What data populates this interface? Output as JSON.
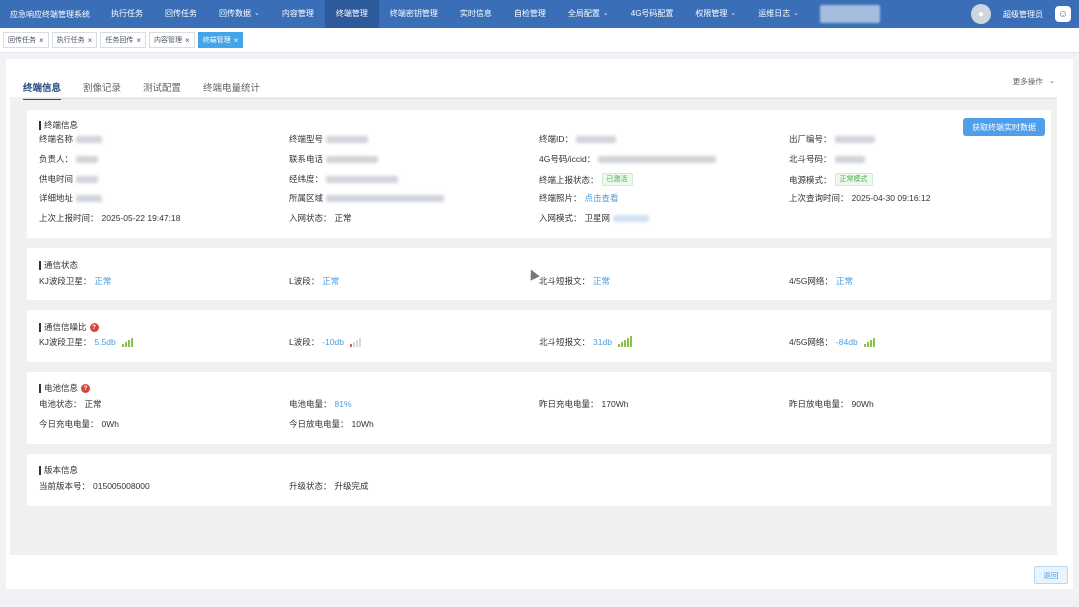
{
  "app": {
    "title": "应急响应终端管理系统",
    "nav": [
      {
        "label": "执行任务",
        "dropdown": false,
        "active": false
      },
      {
        "label": "回传任务",
        "dropdown": false,
        "active": false
      },
      {
        "label": "回传数据",
        "dropdown": true,
        "active": false
      },
      {
        "label": "内容管理",
        "dropdown": false,
        "active": false
      },
      {
        "label": "终端管理",
        "dropdown": false,
        "active": true
      },
      {
        "label": "终端密钥管理",
        "dropdown": false,
        "active": false
      },
      {
        "label": "实时信息",
        "dropdown": false,
        "active": false
      },
      {
        "label": "自检管理",
        "dropdown": false,
        "active": false
      },
      {
        "label": "全局配置",
        "dropdown": true,
        "active": false
      },
      {
        "label": "4G号码配置",
        "dropdown": false,
        "active": false
      },
      {
        "label": "权限管理",
        "dropdown": true,
        "active": false
      },
      {
        "label": "运维日志",
        "dropdown": true,
        "active": false
      }
    ],
    "user": "超级管理员"
  },
  "page_tabs": [
    {
      "label": "回传任务",
      "active": false
    },
    {
      "label": "执行任务",
      "active": false
    },
    {
      "label": "任务回传",
      "active": false
    },
    {
      "label": "内容管理",
      "active": false
    },
    {
      "label": "终端管理",
      "active": true
    }
  ],
  "subtabs": [
    {
      "label": "终端信息",
      "active": true
    },
    {
      "label": "割像记录",
      "active": false
    },
    {
      "label": "测试配置",
      "active": false
    },
    {
      "label": "终端电量统计",
      "active": false
    }
  ],
  "more_ops": "更多操作",
  "terminal_info": {
    "title": "终端信息",
    "fetch_button": "获取终端实时数据",
    "labels": {
      "name": "终端名称",
      "model": "终端型号",
      "terminal_id": "终端ID：",
      "factory_no": "出厂编号：",
      "owner": "负责人：",
      "phone": "联系电话",
      "iccid": "4G号码/iccid：",
      "beidou_no": "北斗号码：",
      "install_time": "供电时间",
      "coords": "经纬度：",
      "report_status": "终端上报状态：",
      "power_mode": "电源模式：",
      "address": "详细地址",
      "region": "所属区域",
      "photo": "终端照片：",
      "last_query": "上次查询时间：",
      "last_report": "上次上报时间：",
      "net_status": "入网状态：",
      "net_mode": "入网模式："
    },
    "values": {
      "report_status": "已激活",
      "power_mode": "正常模式",
      "photo": "点击查看",
      "last_query": "2025-04-30 09:16:12",
      "last_report": "2025-05-22 19:47:18",
      "net_status": "正常",
      "net_mode": "卫星网"
    }
  },
  "comm_status": {
    "title": "通信状态",
    "items": [
      {
        "label": "KJ波段卫星：",
        "value": "正常"
      },
      {
        "label": "L波段：",
        "value": "正常"
      },
      {
        "label": "北斗短报文：",
        "value": "正常"
      },
      {
        "label": "4/5G网络：",
        "value": "正常"
      }
    ]
  },
  "signal_ratio": {
    "title": "通信信噪比",
    "items": [
      {
        "label": "KJ波段卫星：",
        "value": "5.5db"
      },
      {
        "label": "L波段：",
        "value": "-10db"
      },
      {
        "label": "北斗短报文：",
        "value": "31db"
      },
      {
        "label": "4/5G网络：",
        "value": "-84db"
      }
    ]
  },
  "battery": {
    "title": "电池信息",
    "items": [
      {
        "label": "电池状态：",
        "value": "正常"
      },
      {
        "label": "电池电量：",
        "value": "81%"
      },
      {
        "label": "昨日充电电量：",
        "value": "170Wh"
      },
      {
        "label": "昨日放电电量：",
        "value": "90Wh"
      },
      {
        "label": "今日充电电量：",
        "value": "0Wh"
      },
      {
        "label": "今日放电电量：",
        "value": "10Wh"
      }
    ]
  },
  "version": {
    "title": "版本信息",
    "items": [
      {
        "label": "当前版本号：",
        "value": "015005008000"
      },
      {
        "label": "升级状态：",
        "value": "升级完成"
      }
    ]
  },
  "back_button": "返回",
  "colors": {
    "nav_bg": "#3a6fb7",
    "accent": "#4a9de0",
    "success": "#49b04d",
    "alert": "#d9443a"
  }
}
